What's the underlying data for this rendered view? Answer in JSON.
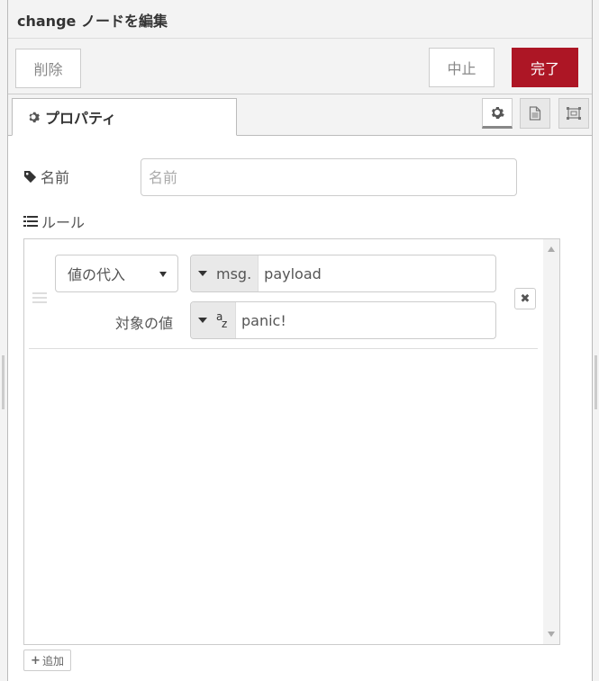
{
  "header": {
    "title": "change ノードを編集"
  },
  "toolbar": {
    "delete_label": "削除",
    "cancel_label": "中止",
    "done_label": "完了",
    "done_color": "#ad1625"
  },
  "tabs": {
    "properties_label": "プロパティ",
    "icons": [
      "gear-icon",
      "description-icon",
      "appearance-icon"
    ]
  },
  "form": {
    "name_label": "名前",
    "name_placeholder": "名前",
    "name_value": "",
    "rules_label": "ルール"
  },
  "rules": [
    {
      "action": "値の代入",
      "target_type": "msg.",
      "target_value": "payload",
      "to_label": "対象の値",
      "value_type_icon": "string-az-icon",
      "value_type_a": "a",
      "value_type_z": "z",
      "value": "panic!"
    }
  ],
  "add_button_label": "追加"
}
